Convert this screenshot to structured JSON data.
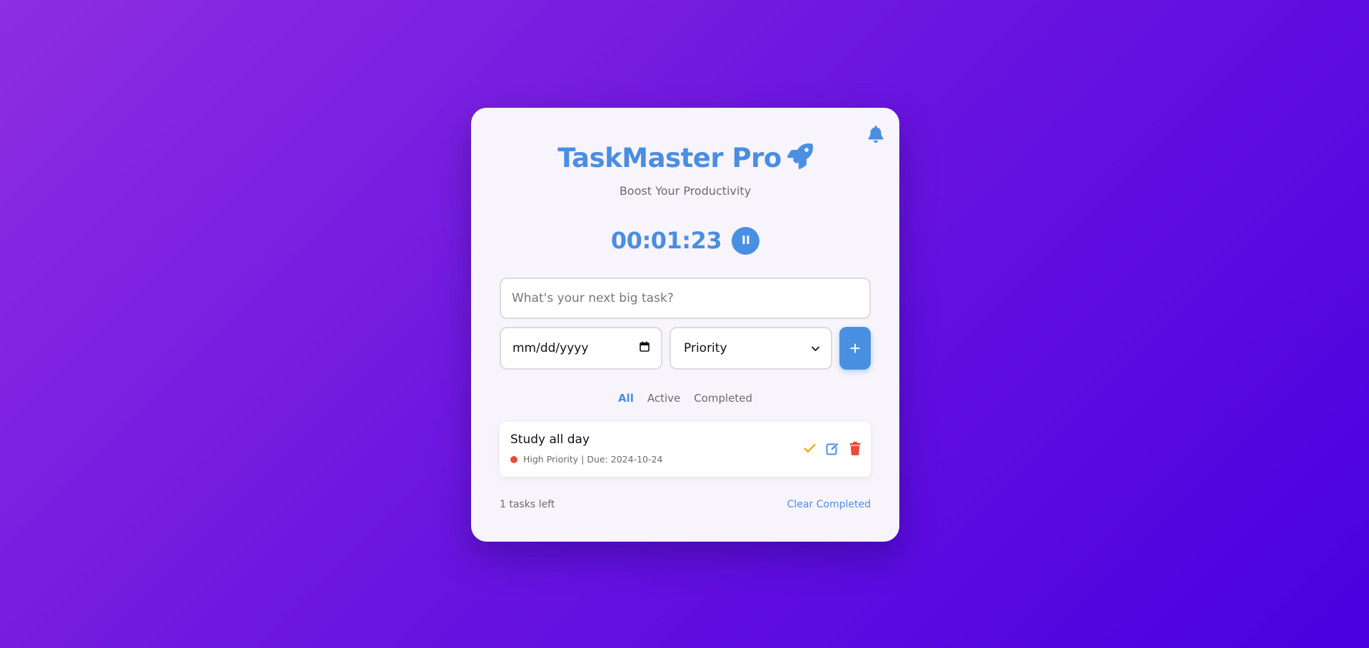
{
  "app": {
    "title": "TaskMaster Pro",
    "subtitle": "Boost Your Productivity"
  },
  "icons": {
    "header": "rocket-icon",
    "notifications": "bell-icon",
    "pause": "pause-icon",
    "complete": "check-icon",
    "edit": "edit-icon",
    "delete": "trash-icon",
    "calendar": "calendar-icon",
    "dropdown": "chevron-down-icon"
  },
  "timer": {
    "value": "00:01:23"
  },
  "form": {
    "task_placeholder": "What's your next big task?",
    "date_placeholder": "mm/dd/yyyy",
    "priority_selected": "Priority",
    "add_label": "+"
  },
  "filters": [
    {
      "label": "All",
      "active": true
    },
    {
      "label": "Active",
      "active": false
    },
    {
      "label": "Completed",
      "active": false
    }
  ],
  "tasks": [
    {
      "name": "Study all day",
      "meta": "High Priority | Due: 2024-10-24",
      "priority_color": "#e74c3c"
    }
  ],
  "footer": {
    "tasks_left": "1 tasks left",
    "clear_label": "Clear Completed"
  },
  "colors": {
    "accent": "#4a90e2",
    "high_priority": "#e74c3c",
    "check": "#f0a500",
    "delete": "#e74c3c"
  }
}
